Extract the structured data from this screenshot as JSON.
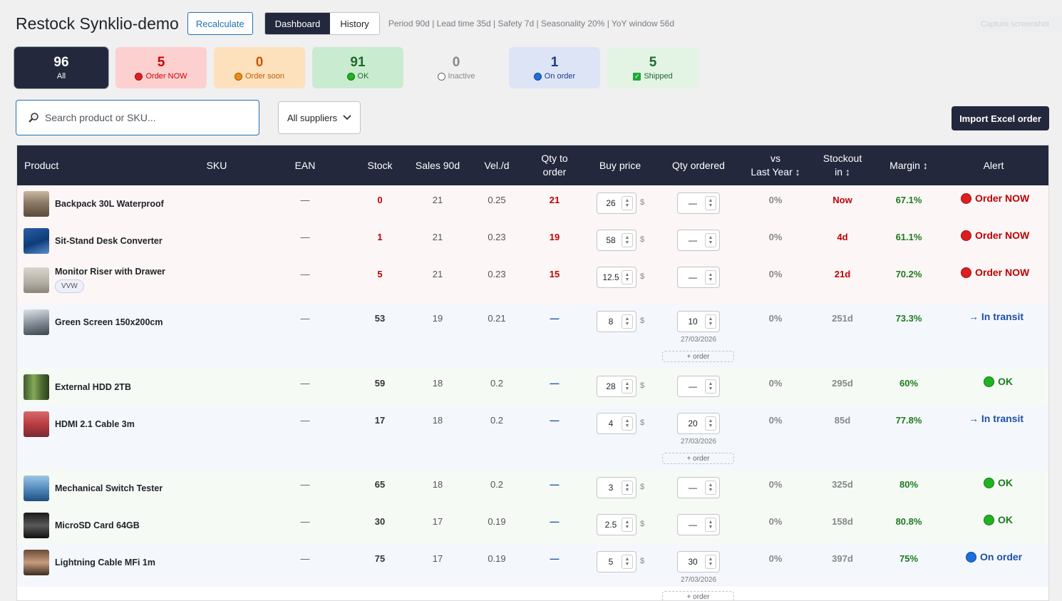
{
  "header": {
    "title": "Restock Synklio-demo",
    "recalculate_label": "Recalculate",
    "tabs": [
      {
        "label": "Dashboard",
        "active": true
      },
      {
        "label": "History",
        "active": false
      }
    ],
    "params": "Period 90d | Lead time 35d | Safety 7d | Seasonality 20% | YoY window 56d",
    "capture_label": "Capture screenshot"
  },
  "cards": [
    {
      "count": "96",
      "label": "All"
    },
    {
      "count": "5",
      "label": "Order NOW"
    },
    {
      "count": "0",
      "label": "Order soon"
    },
    {
      "count": "91",
      "label": "OK"
    },
    {
      "count": "0",
      "label": "Inactive"
    },
    {
      "count": "1",
      "label": "On order"
    },
    {
      "count": "5",
      "label": "Shipped"
    }
  ],
  "search": {
    "placeholder": "Search product or SKU..."
  },
  "supplier_filter": {
    "selected": "All suppliers"
  },
  "import_label": "Import Excel order",
  "columns": {
    "product": "Product",
    "sku": "SKU",
    "ean": "EAN",
    "stock": "Stock",
    "sales": "Sales 90d",
    "vel": "Vel./d",
    "qty_to_order_1": "Qty to",
    "qty_to_order_2": "order",
    "buy_price": "Buy price",
    "qty_ordered": "Qty ordered",
    "vs_ly_1": "vs",
    "vs_ly_2": "Last Year ↕",
    "stockout_1": "Stockout",
    "stockout_2": "in ↕",
    "margin": "Margin ↕",
    "alert": "Alert"
  },
  "currency": "$",
  "add_order_label": "+ order",
  "colors": {
    "dark": "#23283d",
    "red": "#c00000",
    "green": "#1d7a1d",
    "blue": "#1e4fa8"
  },
  "rows": [
    {
      "name": "Backpack 30L Waterproof",
      "ean": "—",
      "stock": "0",
      "sales": "21",
      "vel": "0.25",
      "qto": "21",
      "price": "26",
      "qord": "—",
      "vsly": "0%",
      "stockout": "Now",
      "margin": "67.1%",
      "alert": "Order NOW",
      "alert_type": "now",
      "bg": "#fdf6f6",
      "thumb": "mountain",
      "tag": "",
      "date": ""
    },
    {
      "name": "Sit-Stand Desk Converter",
      "ean": "—",
      "stock": "1",
      "sales": "21",
      "vel": "0.23",
      "qto": "19",
      "price": "58",
      "qord": "—",
      "vsly": "0%",
      "stockout": "4d",
      "margin": "61.1%",
      "alert": "Order NOW",
      "alert_type": "now",
      "bg": "#fdf6f6",
      "thumb": "ocean",
      "tag": "",
      "date": ""
    },
    {
      "name": "Monitor Riser with Drawer",
      "ean": "—",
      "stock": "5",
      "sales": "21",
      "vel": "0.23",
      "qto": "15",
      "price": "12.5",
      "qord": "—",
      "vsly": "0%",
      "stockout": "21d",
      "margin": "70.2%",
      "alert": "Order NOW",
      "alert_type": "now",
      "bg": "#fdf6f6",
      "thumb": "fog",
      "tag": "VVW",
      "date": ""
    },
    {
      "name": "Green Screen 150x200cm",
      "ean": "—",
      "stock": "53",
      "sales": "19",
      "vel": "0.21",
      "qto": "—",
      "price": "8",
      "qord": "10",
      "vsly": "0%",
      "stockout": "251d",
      "margin": "73.3%",
      "alert": "→ In transit",
      "alert_type": "transit",
      "bg": "#f4f8fd",
      "thumb": "peak",
      "tag": "",
      "date": "27/03/2026"
    },
    {
      "name": "External HDD 2TB",
      "ean": "—",
      "stock": "59",
      "sales": "18",
      "vel": "0.2",
      "qto": "—",
      "price": "28",
      "qord": "—",
      "vsly": "0%",
      "stockout": "295d",
      "margin": "60%",
      "alert": "OK",
      "alert_type": "ok",
      "bg": "#f5faf5",
      "thumb": "forest",
      "tag": "",
      "date": ""
    },
    {
      "name": "HDMI 2.1 Cable 3m",
      "ean": "—",
      "stock": "17",
      "sales": "18",
      "vel": "0.2",
      "qto": "—",
      "price": "4",
      "qord": "20",
      "vsly": "0%",
      "stockout": "85d",
      "margin": "77.8%",
      "alert": "→ In transit",
      "alert_type": "transit",
      "bg": "#f4f8fd",
      "thumb": "autumn",
      "tag": "",
      "date": "27/03/2026"
    },
    {
      "name": "Mechanical Switch Tester",
      "ean": "—",
      "stock": "65",
      "sales": "18",
      "vel": "0.2",
      "qto": "—",
      "price": "3",
      "qord": "—",
      "vsly": "0%",
      "stockout": "325d",
      "margin": "80%",
      "alert": "OK",
      "alert_type": "ok",
      "bg": "#f5faf5",
      "thumb": "glacier",
      "tag": "",
      "date": ""
    },
    {
      "name": "MicroSD Card 64GB",
      "ean": "—",
      "stock": "30",
      "sales": "17",
      "vel": "0.19",
      "qto": "—",
      "price": "2.5",
      "qord": "—",
      "vsly": "0%",
      "stockout": "158d",
      "margin": "80.8%",
      "alert": "OK",
      "alert_type": "ok",
      "bg": "#f5faf5",
      "thumb": "dark",
      "tag": "",
      "date": ""
    },
    {
      "name": "Lightning Cable MFi 1m",
      "ean": "—",
      "stock": "75",
      "sales": "17",
      "vel": "0.19",
      "qto": "—",
      "price": "5",
      "qord": "30",
      "vsly": "0%",
      "stockout": "397d",
      "margin": "75%",
      "alert": "On order",
      "alert_type": "onorder",
      "bg": "#f4f8fd",
      "thumb": "portrait",
      "tag": "",
      "date": "27/03/2026"
    }
  ]
}
